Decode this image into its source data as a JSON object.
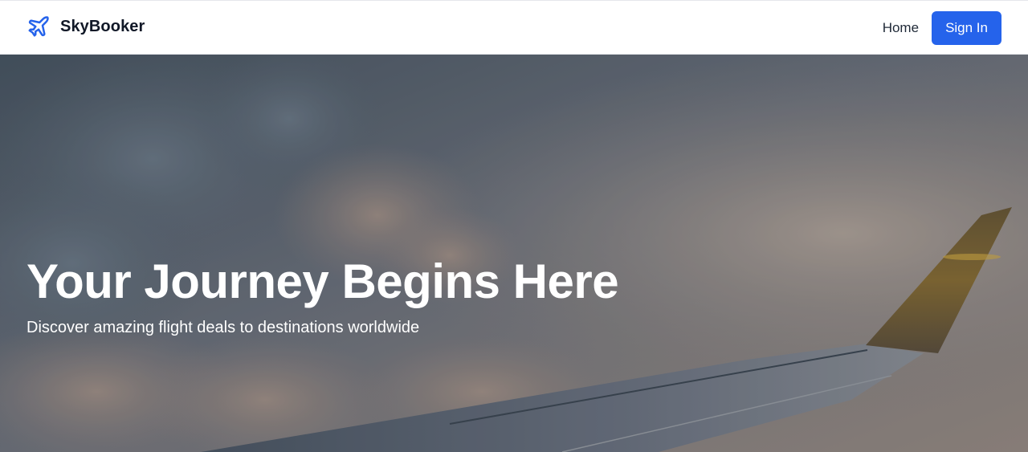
{
  "navbar": {
    "brand_name": "SkyBooker",
    "brand_icon": "airplane-icon",
    "links": [
      {
        "label": "Home"
      }
    ],
    "signin_label": "Sign In"
  },
  "hero": {
    "title": "Your Journey Begins Here",
    "subtitle": "Discover amazing flight deals to destinations worldwide",
    "background": "sky-clouds-airplane-wing-photo"
  },
  "colors": {
    "accent": "#2563eb",
    "brand_icon": "#2563eb",
    "heading": "#111827",
    "hero_text": "#ffffff"
  }
}
